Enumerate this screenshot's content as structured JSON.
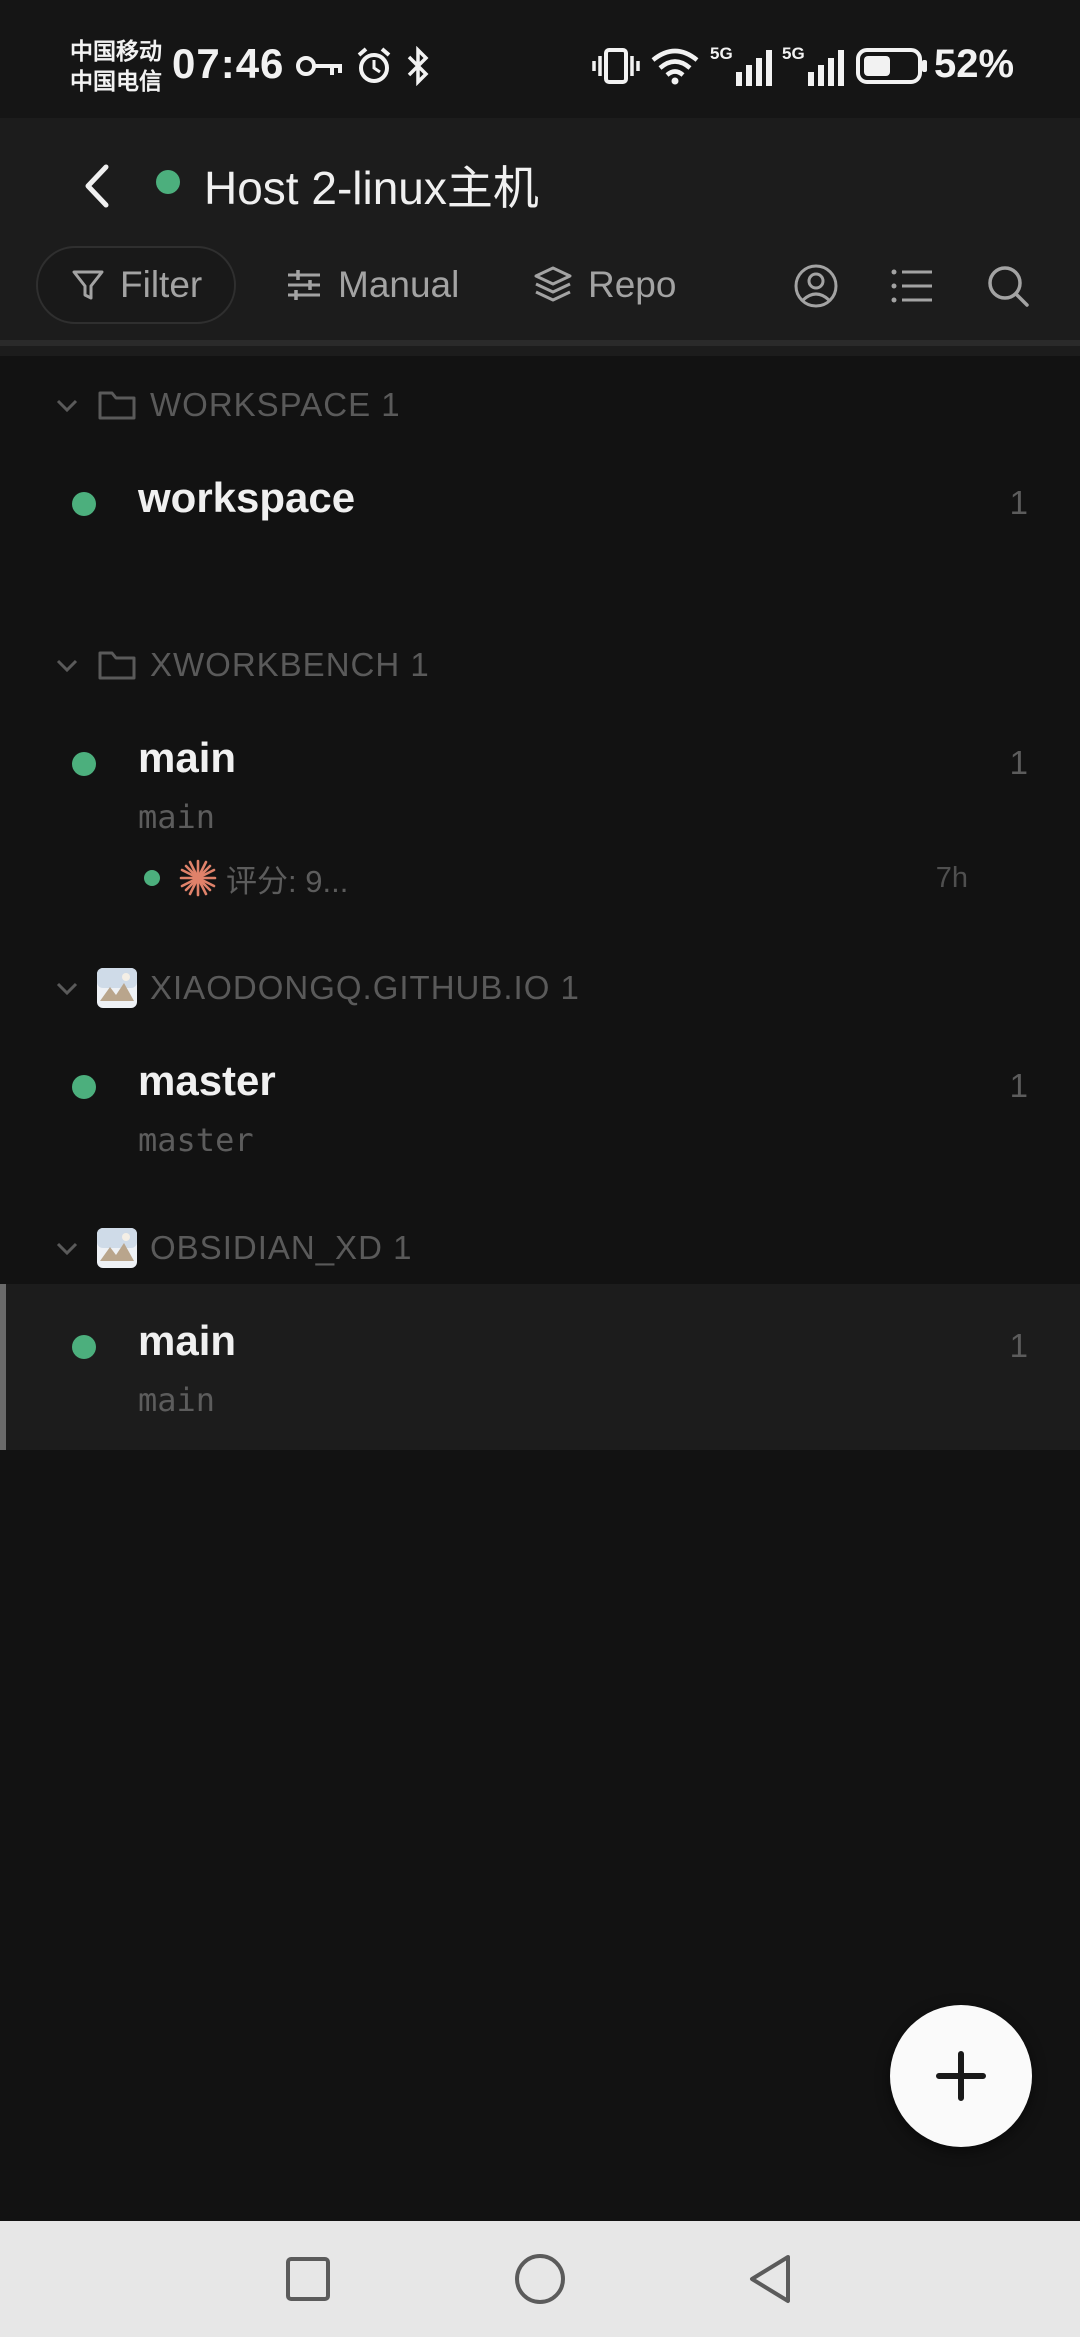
{
  "status_bar": {
    "carrier_1": "中国移动",
    "carrier_2": "中国电信",
    "time": "07:46",
    "network_1": "5G",
    "network_2": "5G",
    "battery_percent": "52%",
    "battery_level": 0.52,
    "icons": [
      "key-icon",
      "alarm-icon",
      "bluetooth-icon",
      "vibrate-icon",
      "wifi-icon",
      "signal-icon",
      "battery-icon"
    ]
  },
  "header": {
    "title": "Host 2-linux主机",
    "status_color": "#4caf7d"
  },
  "toolbar": {
    "filter_label": "Filter",
    "manual_label": "Manual",
    "repo_label": "Repo",
    "right_icons": [
      "user-circle-icon",
      "list-icon",
      "search-icon"
    ]
  },
  "groups": [
    {
      "label": "WORKSPACE",
      "count": "1",
      "icon": "folder-icon",
      "items": [
        {
          "title": "workspace",
          "subtitle": "",
          "count": "1"
        }
      ]
    },
    {
      "label": "XWORKBENCH",
      "count": "1",
      "icon": "folder-icon",
      "items": [
        {
          "title": "main",
          "subtitle": "main",
          "count": "1",
          "session": {
            "icon": "sparkle-icon",
            "text": "评分: 9...",
            "time": "7h"
          }
        }
      ]
    },
    {
      "label": "XIAODONGQ.GITHUB.IO",
      "count": "1",
      "icon": "repo-avatar-icon",
      "items": [
        {
          "title": "master",
          "subtitle": "master",
          "count": "1"
        }
      ]
    },
    {
      "label": "OBSIDIAN_XD",
      "count": "1",
      "icon": "repo-avatar-icon",
      "items": [
        {
          "title": "main",
          "subtitle": "main",
          "count": "1",
          "selected": true
        }
      ]
    }
  ],
  "fab": {
    "icon": "plus-icon"
  },
  "nav_bar": {
    "buttons": [
      "recents-square-icon",
      "home-circle-icon",
      "back-triangle-icon"
    ]
  },
  "colors": {
    "background": "#121212",
    "surface": "#1c1c1c",
    "accent_green": "#4caf7d",
    "sparkle_orange": "#e0826a"
  }
}
